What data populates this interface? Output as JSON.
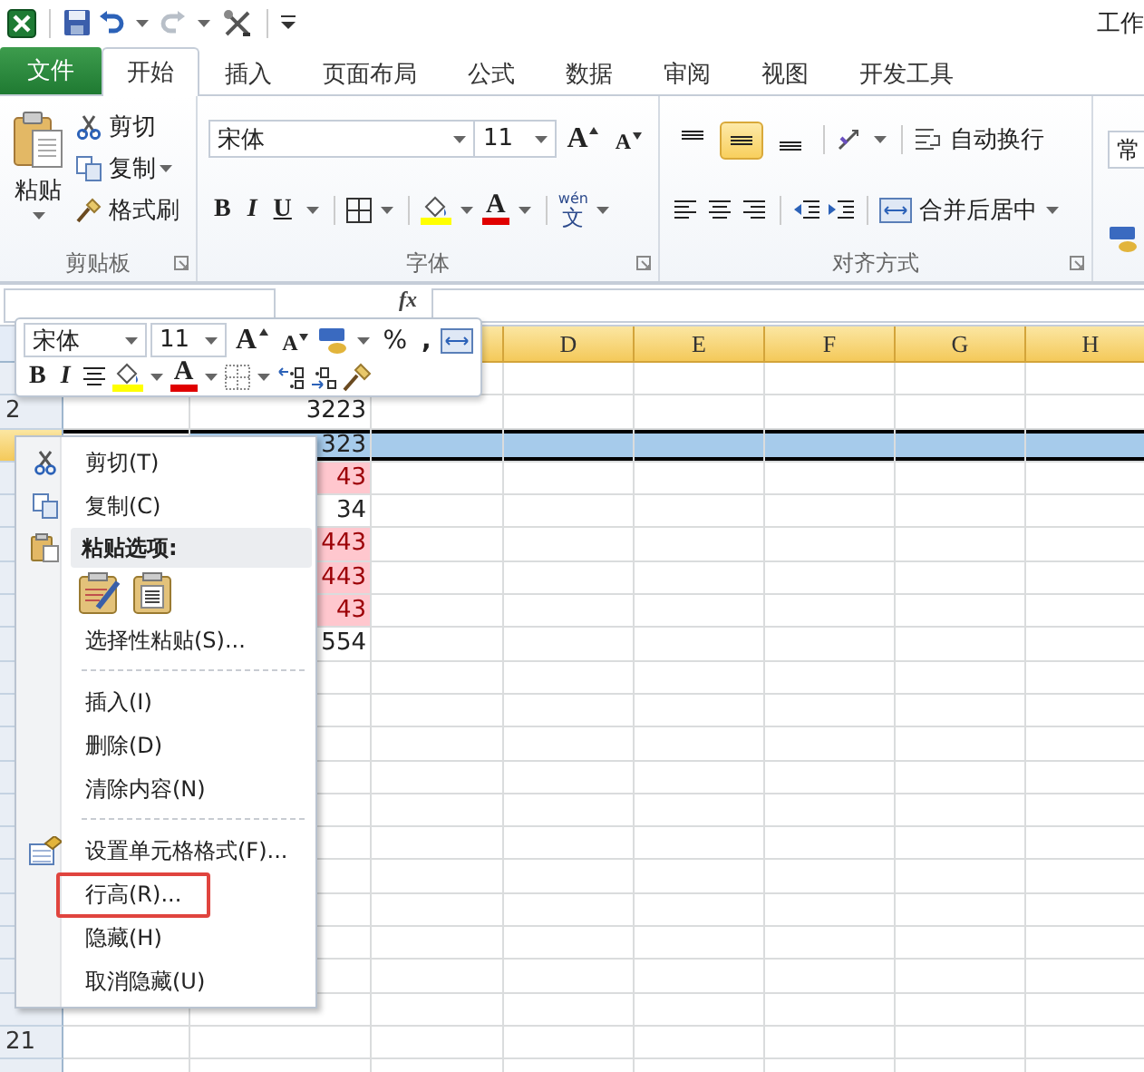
{
  "title_bar": {
    "title": "工作"
  },
  "file_tab": {
    "label": "文件"
  },
  "tabs": [
    {
      "label": "开始",
      "selected": true
    },
    {
      "label": "插入",
      "selected": false
    },
    {
      "label": "页面布局",
      "selected": false
    },
    {
      "label": "公式",
      "selected": false
    },
    {
      "label": "数据",
      "selected": false
    },
    {
      "label": "审阅",
      "selected": false
    },
    {
      "label": "视图",
      "selected": false
    },
    {
      "label": "开发工具",
      "selected": false
    }
  ],
  "ribbon": {
    "clipboard": {
      "paste": "粘贴",
      "cut": "剪切",
      "copy": "复制",
      "format_painter": "格式刷",
      "label": "剪贴板"
    },
    "font": {
      "font_name": "宋体",
      "font_size": "11",
      "grow": "A",
      "shrink": "A",
      "bold": "B",
      "italic": "I",
      "underline": "U",
      "font_color_letter": "A",
      "phonetic_top": "wén",
      "phonetic": "文",
      "label": "字体"
    },
    "alignment": {
      "vertical_align": [
        {
          "selected": false
        },
        {
          "selected": true
        },
        {
          "selected": false
        }
      ],
      "wrap_text": "自动换行",
      "merge_center": "合并后居中",
      "label": "对齐方式"
    },
    "number": {
      "format": "常"
    }
  },
  "formula_bar": {
    "fx": "fx"
  },
  "columns": [
    "D",
    "E",
    "F",
    "G",
    "H"
  ],
  "rows": [
    {
      "selected": false
    },
    {
      "number": "2",
      "value": "3223",
      "kind": "plain",
      "selected": false
    },
    {
      "value": "323",
      "kind": "plain",
      "selected": true
    },
    {
      "value": "43",
      "kind": "flagged",
      "selected": false
    },
    {
      "value": "34",
      "kind": "plain",
      "selected": false
    },
    {
      "value": "443",
      "kind": "flagged",
      "selected": false
    },
    {
      "value": "443",
      "kind": "flagged",
      "selected": false
    },
    {
      "value": "43",
      "kind": "flagged",
      "selected": false
    },
    {
      "value": "554",
      "kind": "plain",
      "selected": false
    },
    {
      "selected": false
    },
    {
      "selected": false
    },
    {
      "selected": false
    },
    {
      "selected": false
    },
    {
      "selected": false
    },
    {
      "selected": false
    },
    {
      "selected": false
    },
    {
      "selected": false
    },
    {
      "selected": false
    },
    {
      "selected": false
    },
    {
      "selected": false
    },
    {
      "number": "21",
      "selected": false
    },
    {
      "selected": false
    }
  ],
  "mini_toolbar": {
    "font_name": "宋体",
    "font_size": "11",
    "grow": "A",
    "shrink": "A",
    "percent": "%",
    "comma": ",",
    "bold": "B",
    "italic": "I",
    "font_color_letter": "A"
  },
  "context_menu": [
    {
      "kind": "cut",
      "label": "剪切(T)",
      "highlighted": false
    },
    {
      "kind": "copy",
      "label": "复制(C)",
      "highlighted": false
    },
    {
      "kind": "paste_header",
      "label": "粘贴选项:",
      "highlighted": false
    },
    {
      "kind": "paste_buttons"
    },
    {
      "kind": "item",
      "label": "选择性粘贴(S)...",
      "highlighted": false
    },
    {
      "kind": "separator"
    },
    {
      "kind": "item",
      "label": "插入(I)",
      "highlighted": false
    },
    {
      "kind": "item",
      "label": "删除(D)",
      "highlighted": false
    },
    {
      "kind": "item",
      "label": "清除内容(N)",
      "highlighted": false
    },
    {
      "kind": "separator"
    },
    {
      "kind": "format_cells",
      "label": "设置单元格格式(F)...",
      "highlighted": false
    },
    {
      "kind": "item",
      "label": "行高(R)...",
      "highlighted": true
    },
    {
      "kind": "item",
      "label": "隐藏(H)",
      "highlighted": false
    },
    {
      "kind": "item",
      "label": "取消隐藏(U)",
      "highlighted": false
    }
  ]
}
